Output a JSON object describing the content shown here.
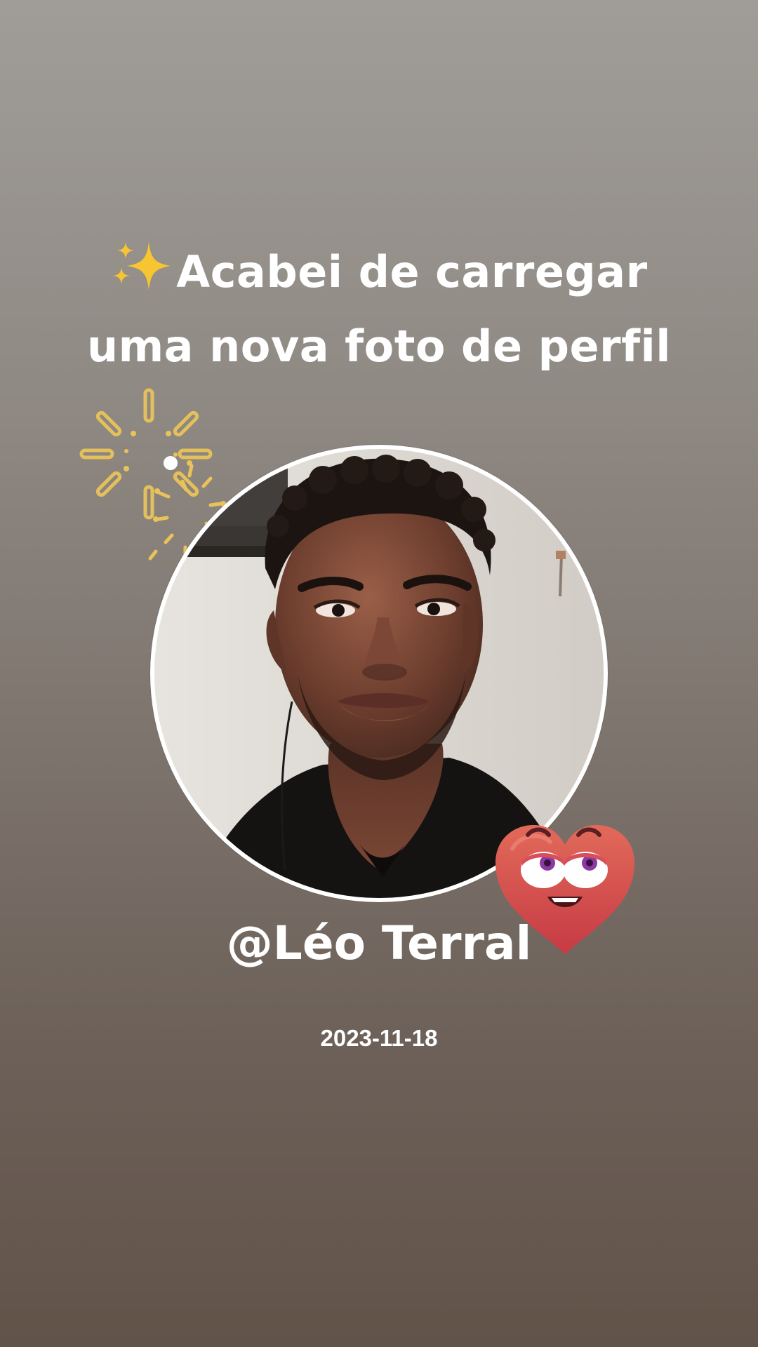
{
  "story": {
    "headline_line1": "Acabei de carregar",
    "headline_line2": "uma nova foto de perfil",
    "headline_prefix_icon": "sparkles-icon",
    "username": "@Léo Terral",
    "date": "2023-11-18"
  },
  "decorations": {
    "burst_icon": "fireworks-burst-icon",
    "sticker_icon": "heart-face-sticker-icon"
  },
  "colors": {
    "background_top": "#a09d98",
    "background_bottom": "#625349",
    "text": "#ffffff",
    "burst": "#e9c35a",
    "heart": "#d9534f"
  }
}
